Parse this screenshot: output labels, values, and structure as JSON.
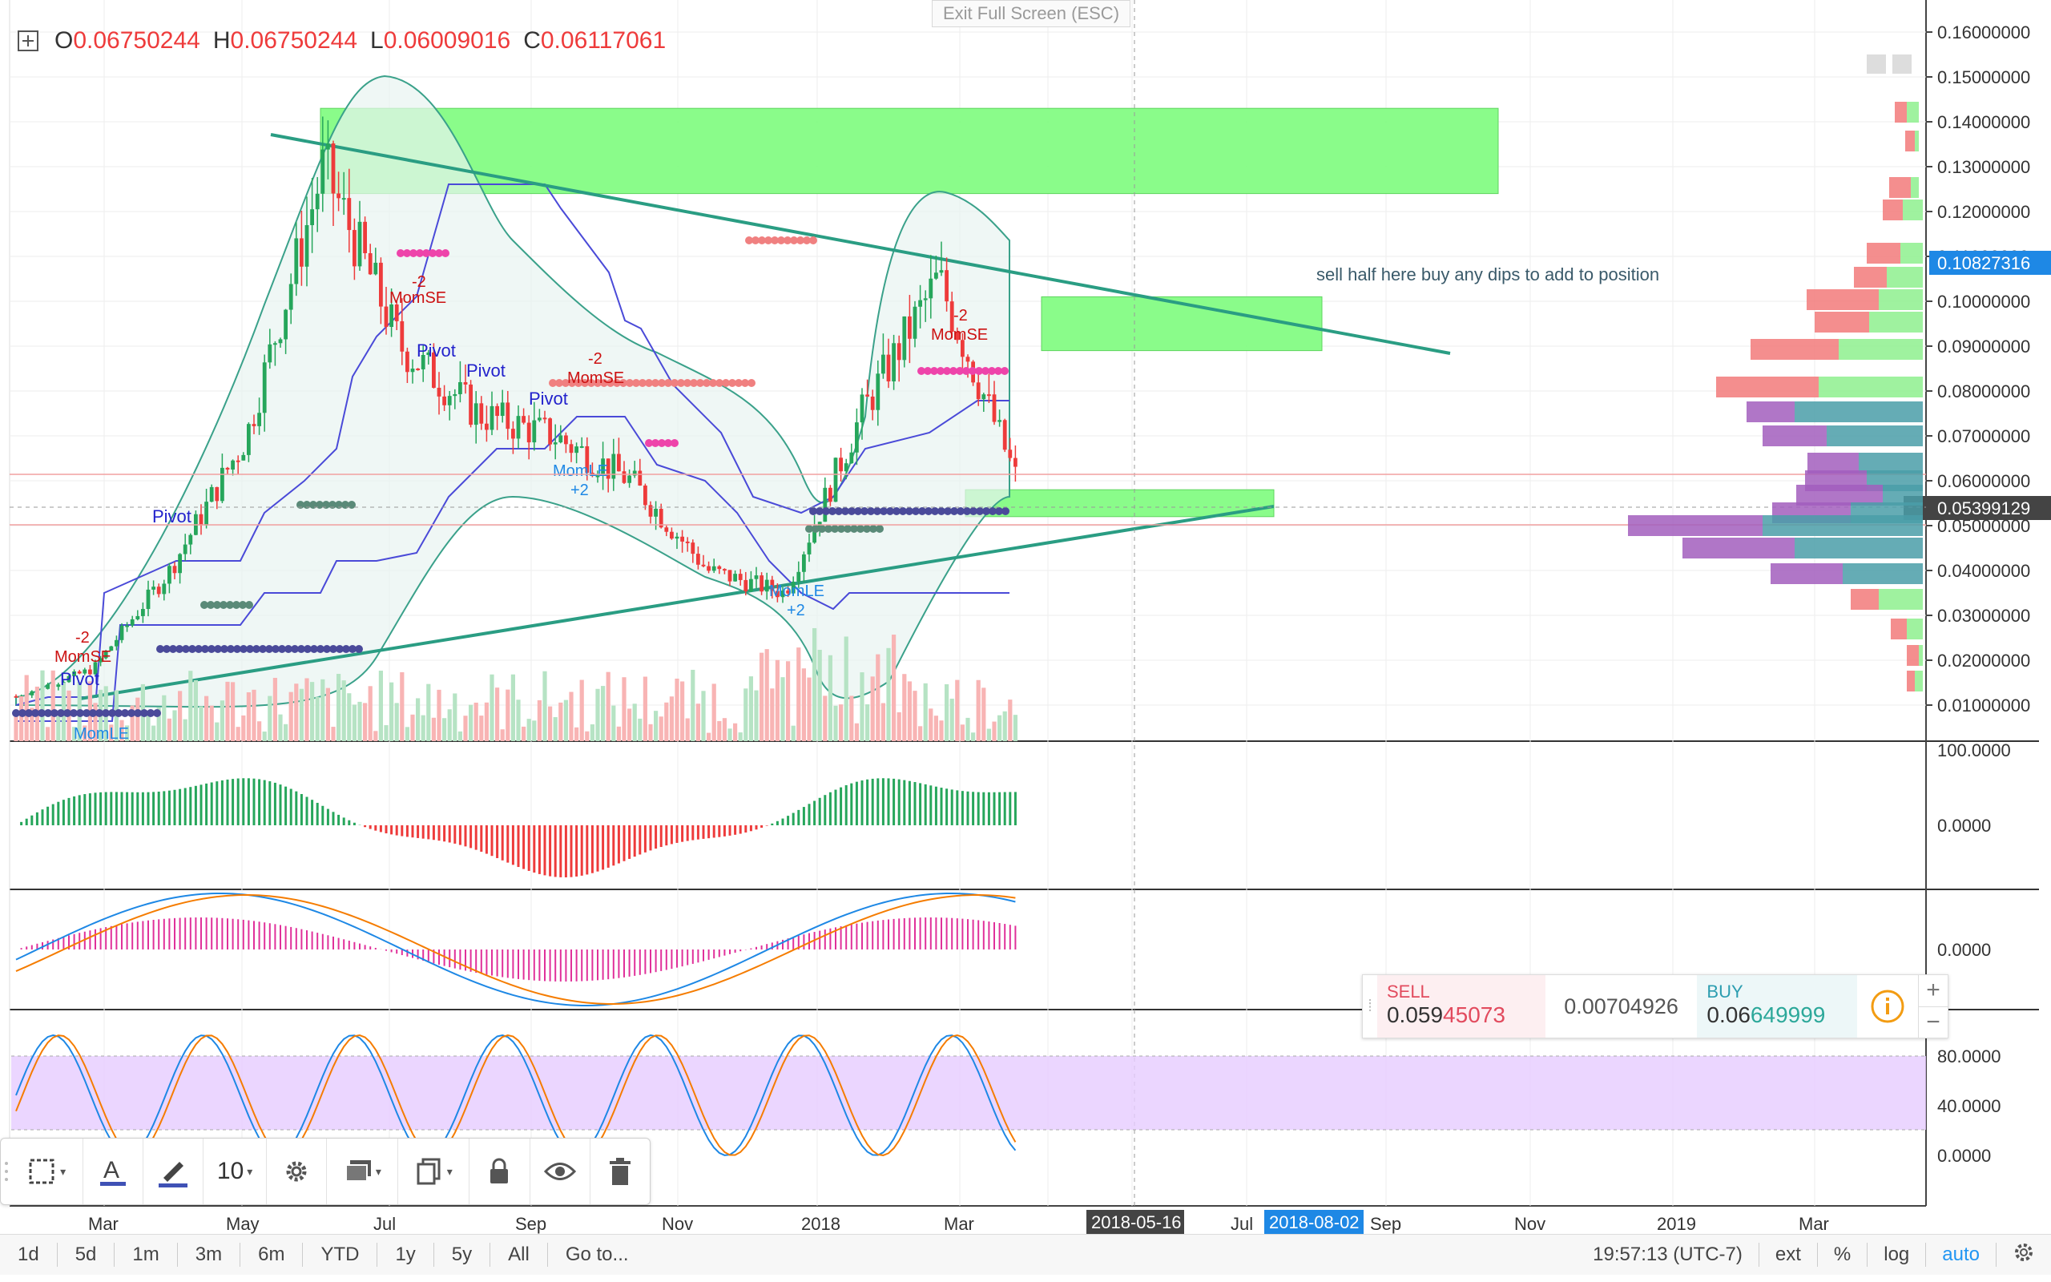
{
  "ohlc": {
    "o_label": "O",
    "o_value": "0.06750244",
    "h_label": "H",
    "h_value": "0.06750244",
    "l_label": "L",
    "l_value": "0.06009016",
    "c_label": "C",
    "c_value": "0.06117061"
  },
  "exit_fullscreen": "Exit Full Screen (ESC)",
  "annotation_text": "sell half here buy any dips to add to position",
  "price_axis": {
    "ticks": [
      "0.16000000",
      "0.15000000",
      "0.14000000",
      "0.13000000",
      "0.12000000",
      "0.11000000",
      "0.10000000",
      "0.09000000",
      "0.08000000",
      "0.07000000",
      "0.06000000",
      "0.05000000",
      "0.04000000",
      "0.03000000",
      "0.02000000",
      "0.01000000"
    ],
    "current_price_label": "0.10827316",
    "crosshair_price_label": "0.05399129"
  },
  "indicator_axes": {
    "pane1_top": "100.0000",
    "pane1_zero": "0.0000",
    "pane2_zero": "0.0000",
    "pane3_80": "80.0000",
    "pane3_40": "40.0000",
    "pane3_0": "0.0000"
  },
  "time_axis": {
    "labels": [
      "Mar",
      "May",
      "Jul",
      "Sep",
      "Nov",
      "2018",
      "Mar",
      "Jul",
      "Sep",
      "Nov",
      "2019",
      "Mar"
    ],
    "highlight_1": "2018-05-16",
    "highlight_2": "2018-08-02"
  },
  "study_labels": {
    "pivot": "Pivot",
    "momse": "MomSE",
    "momle": "MomLE",
    "minus2": "-2",
    "plus2": "+2"
  },
  "toolbar": {
    "font_size": "10"
  },
  "bottom_bar": {
    "ranges": [
      "1d",
      "5d",
      "1m",
      "3m",
      "6m",
      "YTD",
      "1y",
      "5y",
      "All"
    ],
    "goto": "Go to...",
    "clock": "19:57:13 (UTC-7)",
    "ext": "ext",
    "percent": "%",
    "log": "log",
    "auto": "auto"
  },
  "trade_panel": {
    "sell_label": "SELL",
    "sell_price_main": "0.059",
    "sell_price_big": "45073",
    "spread": "0.00704926",
    "buy_label": "BUY",
    "buy_price_main": "0.06",
    "buy_price_big": "649999"
  },
  "colors": {
    "up": "#26a65b",
    "down": "#ee3b3b",
    "zone_green": "#7dfc7d",
    "trendline": "#2a9d83",
    "stoch_band": "#e6ccff",
    "accent_blue": "#2196f3"
  },
  "chart_data": {
    "type": "candlestick",
    "title": "",
    "price_ylim": [
      0.0,
      0.165
    ],
    "series_approx": {
      "x": [
        "2017-02",
        "2017-03",
        "2017-04",
        "2017-05",
        "2017-06",
        "2017-07",
        "2017-08",
        "2017-09",
        "2017-10",
        "2017-11",
        "2017-12",
        "2018-01",
        "2018-02",
        "2018-03"
      ],
      "close": [
        0.012,
        0.018,
        0.04,
        0.07,
        0.13,
        0.09,
        0.075,
        0.07,
        0.06,
        0.04,
        0.035,
        0.075,
        0.105,
        0.061
      ]
    },
    "zones": [
      {
        "price_low": 0.124,
        "price_high": 0.143
      },
      {
        "price_low": 0.089,
        "price_high": 0.101
      },
      {
        "price_low": 0.052,
        "price_high": 0.058
      }
    ],
    "trendlines": [
      {
        "from": [
          0.137
        ],
        "to": [
          0.088
        ]
      },
      {
        "from": [
          0.011
        ],
        "to": [
          0.054
        ]
      }
    ],
    "current_price": 0.10827316,
    "crosshair_price": 0.05399129
  }
}
